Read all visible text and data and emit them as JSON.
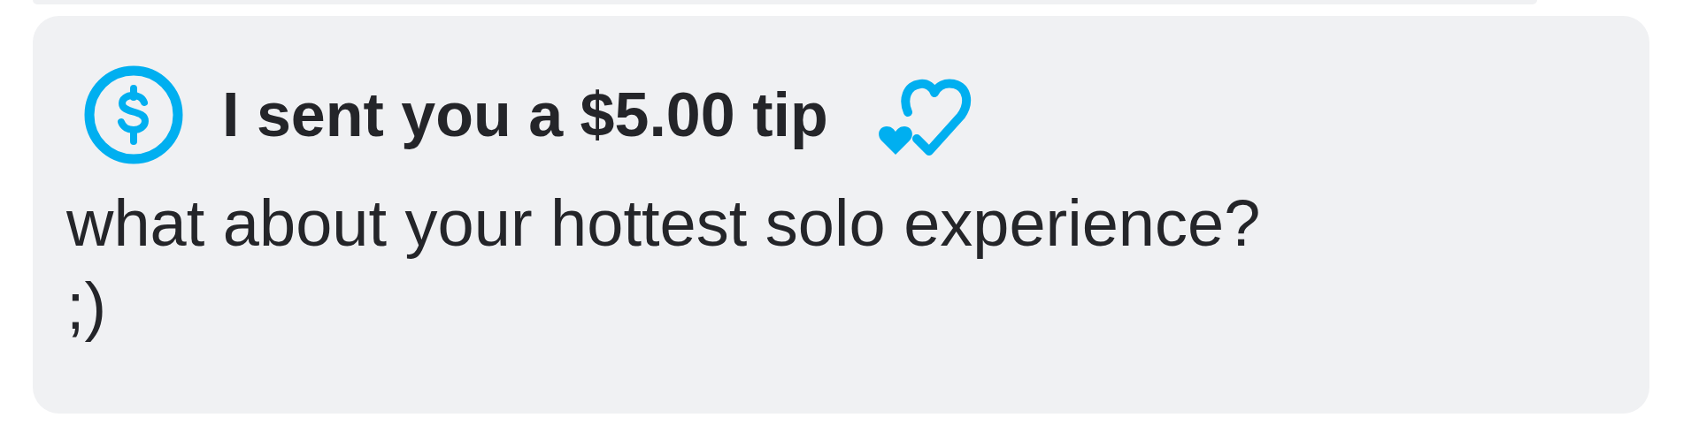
{
  "message": {
    "tip_title": "I sent you a $5.00 tip",
    "text_lines": [
      "what about your hottest solo experience?",
      ";)"
    ]
  }
}
